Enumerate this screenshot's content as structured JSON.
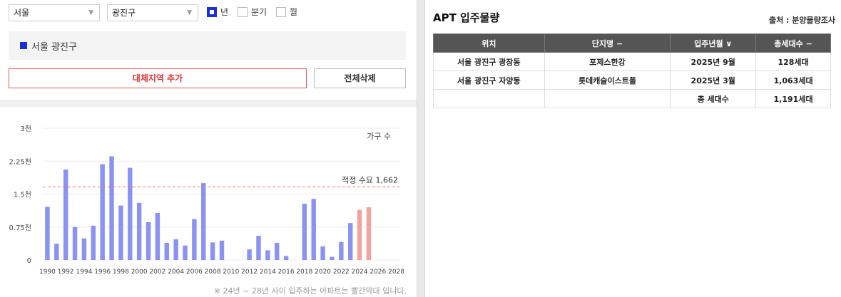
{
  "filters": {
    "city": "서울",
    "district": "광진구",
    "period_options": [
      {
        "label": "년",
        "checked": true
      },
      {
        "label": "분기",
        "checked": false
      },
      {
        "label": "월",
        "checked": false
      }
    ]
  },
  "region_item": "서울 광진구",
  "buttons": {
    "add": "대체지역 추가",
    "delete_all": "전체삭제"
  },
  "colors": {
    "accent": "#1a2fd6",
    "bar": "#8b93f2",
    "bar_highlight": "#f2a3a0",
    "demand_line": "#e57373"
  },
  "chart_data": {
    "type": "bar",
    "title": "",
    "legend_label": "가구 수",
    "ylim": [
      0,
      3000
    ],
    "y_ticks": [
      {
        "value": 0,
        "label": "0"
      },
      {
        "value": 750,
        "label": "0.75천"
      },
      {
        "value": 1500,
        "label": "1.5천"
      },
      {
        "value": 2250,
        "label": "2.25천"
      },
      {
        "value": 3000,
        "label": "3천"
      }
    ],
    "x_tick_labels": [
      "1990",
      "1992",
      "1994",
      "1996",
      "1998",
      "2000",
      "2002",
      "2004",
      "2006",
      "2008",
      "2010",
      "2012",
      "2014",
      "2016",
      "2018",
      "2020",
      "2022",
      "2024",
      "2026",
      "2028"
    ],
    "x": [
      1990,
      1991,
      1992,
      1993,
      1994,
      1995,
      1996,
      1997,
      1998,
      1999,
      2000,
      2001,
      2002,
      2003,
      2004,
      2005,
      2006,
      2007,
      2008,
      2009,
      2010,
      2011,
      2012,
      2013,
      2014,
      2015,
      2016,
      2017,
      2018,
      2019,
      2020,
      2021,
      2022,
      2023,
      2024,
      2025,
      2026,
      2027,
      2028
    ],
    "values": [
      1210,
      370,
      2060,
      750,
      490,
      780,
      2180,
      2360,
      1240,
      2100,
      1300,
      860,
      1070,
      390,
      470,
      330,
      930,
      1750,
      400,
      440,
      0,
      0,
      240,
      550,
      220,
      390,
      90,
      0,
      1280,
      1390,
      310,
      70,
      410,
      840,
      1140,
      1200,
      0,
      0,
      0
    ],
    "highlight_from": 2024,
    "reference_line": {
      "value": 1662,
      "label": "적정 수요 1,662"
    },
    "note": "※ 24년 ~ 28년 사이 입주하는 아파트는 빨간막대 입니다."
  },
  "right": {
    "title": "APT 입주물량",
    "source": "출처 : 분양물량조사",
    "columns": [
      "위치",
      "단지명 −",
      "입주년월 ∨",
      "총세대수 −"
    ],
    "rows": [
      [
        "서울 광진구 광장동",
        "포제스한강",
        "2025년 9월",
        "128세대"
      ],
      [
        "서울 광진구 자양동",
        "롯데캐슬이스트폴",
        "2025년 3월",
        "1,063세대"
      ]
    ],
    "total_label": "총 세대수",
    "total_value": "1,191세대"
  }
}
